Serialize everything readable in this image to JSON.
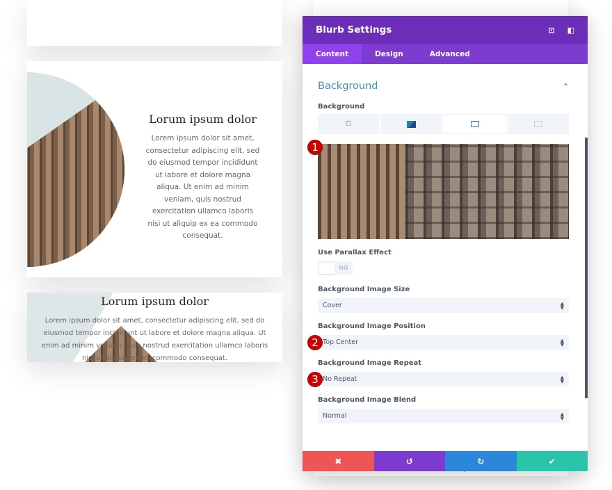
{
  "cards": [
    {
      "title": "Lorum ipsum dolor",
      "text": "Lorem ipsum dolor sit amet, consectetur adipiscing elit, sed do eiusmod tempor incididunt ut labore et dolore magna aliqua. Ut enim ad minim veniam, quis nostrud exercitation ullamco laboris nisi ut aliquip ex ea commodo consequat."
    },
    {
      "title": "Lorum ipsum dolor",
      "text": "Lorem ipsum dolor sit amet, consectetur adipiscing elit, sed do eiusmod tempor incididunt ut labore et dolore magna aliqua. Ut enim ad minim veniam, quis nostrud exercitation ullamco laboris nisi ut aliquip ex ea commodo consequat."
    }
  ],
  "behind_text": "commodo consequat.",
  "panel": {
    "title": "Blurb Settings",
    "tabs": [
      "Content",
      "Design",
      "Advanced"
    ],
    "active_tab": "Content",
    "section_title": "Background",
    "bg_label": "Background",
    "bg_type_tabs": [
      "color",
      "gradient",
      "image",
      "video"
    ],
    "active_bg_type": "image",
    "parallax_label": "Use Parallax Effect",
    "parallax_value": "NO",
    "size_label": "Background Image Size",
    "size_value": "Cover",
    "position_label": "Background Image Position",
    "position_value": "Top Center",
    "repeat_label": "Background Image Repeat",
    "repeat_value": "No Repeat",
    "blend_label": "Background Image Blend",
    "blend_value": "Normal",
    "badges": [
      "1",
      "2",
      "3"
    ],
    "colors": {
      "header": "#6c2eb9",
      "tabs": "#7e3bd0",
      "cancel": "#ef5555",
      "undo": "#7e3bd0",
      "redo": "#2b87da",
      "save": "#29c4a9"
    }
  }
}
